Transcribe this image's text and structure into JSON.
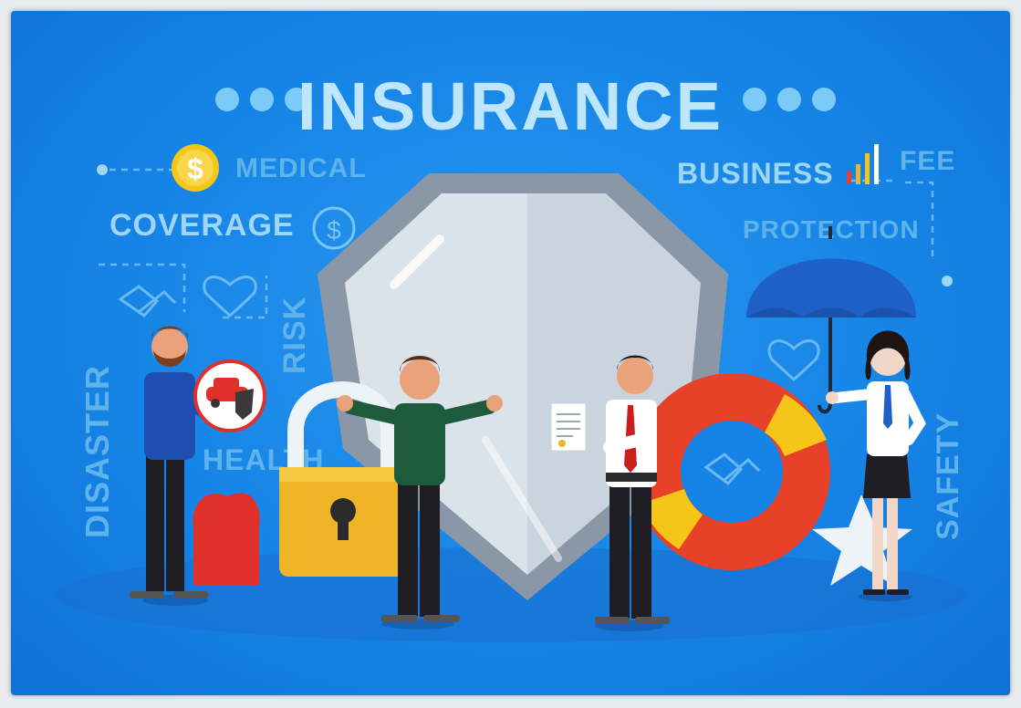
{
  "title": "INSURANCE",
  "keywords": {
    "medical": "MEDICAL",
    "coverage": "COVERAGE",
    "business": "BUSINESS",
    "fee": "FEE",
    "protection": "PROTECTION",
    "risk": "RISK",
    "disaster": "DISASTER",
    "health": "HEALTH",
    "safety": "SAFETY"
  },
  "icons": {
    "coin": "dollar-coin-icon",
    "coverage": "dollar-circle-icon",
    "heart": "heart-outline-icon",
    "handshake": "handshake-icon",
    "bars": "bar-chart-icon"
  },
  "currency_symbol": "$",
  "colors": {
    "background": "#1684e6",
    "title": "#bfe6ff",
    "keyword": "#9fd6f6",
    "coin": "#f5c518",
    "shield": "#c9d4df",
    "lock": "#f0b429",
    "lifebuoy": "#e8412a",
    "heart": "#e0302a",
    "umbrella": "#1f5fc8"
  }
}
